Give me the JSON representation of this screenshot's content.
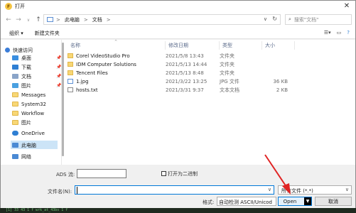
{
  "window": {
    "title": "打开",
    "app_icon": "F",
    "close_glyph": "✕"
  },
  "nav": {
    "back": "←",
    "forward": "→",
    "up_dropdown": "∨",
    "up": "↑",
    "breadcrumbs": [
      "此电脑",
      "文档"
    ],
    "crumb_sep": ">",
    "search_placeholder": "搜索\"文档\""
  },
  "commands": {
    "organize": "组织 ▾",
    "new_folder": "新建文件夹"
  },
  "sidebar": {
    "items": [
      {
        "label": "快速访问",
        "icon": "star-icon",
        "color": "#3b7dd8"
      },
      {
        "label": "桌面",
        "icon": "desktop-icon",
        "color": "#3b8fe0",
        "pinned": true
      },
      {
        "label": "下载",
        "icon": "download-icon",
        "color": "#2f7fd3",
        "pinned": true
      },
      {
        "label": "文档",
        "icon": "documents-icon",
        "color": "#8aa4c8",
        "pinned": true
      },
      {
        "label": "图片",
        "icon": "pictures-icon",
        "color": "#4aa0e0",
        "pinned": true
      },
      {
        "label": "Messages",
        "icon": "folder-icon",
        "color": "#f8d775"
      },
      {
        "label": "System32",
        "icon": "folder-icon",
        "color": "#f8d775"
      },
      {
        "label": "Workflow",
        "icon": "folder-icon",
        "color": "#f8d775"
      },
      {
        "label": "图片",
        "icon": "folder-icon",
        "color": "#f8d775"
      },
      {
        "label": "OneDrive",
        "icon": "onedrive-icon",
        "color": "#2f7fd3"
      },
      {
        "label": "此电脑",
        "icon": "computer-icon",
        "color": "#4a8ad4",
        "selected": true
      },
      {
        "label": "网络",
        "icon": "network-icon",
        "color": "#4a8ad4"
      }
    ],
    "pin_glyph": "📌"
  },
  "file_list": {
    "headers": [
      "名称",
      "修改日期",
      "类型",
      "大小"
    ],
    "sort_glyph": "^",
    "rows": [
      {
        "name": "Corel VideoStudio Pro",
        "date": "2021/5/8 13:43",
        "type": "文件夹",
        "size": "",
        "kind": "folder"
      },
      {
        "name": "IDM Computer Solutions",
        "date": "2021/5/13 14:44",
        "type": "文件夹",
        "size": "",
        "kind": "folder"
      },
      {
        "name": "Tencent Files",
        "date": "2021/5/13 8:48",
        "type": "文件夹",
        "size": "",
        "kind": "folder"
      },
      {
        "name": "1.jpg",
        "date": "2021/3/22 13:25",
        "type": "JPG 文件",
        "size": "36 KB",
        "kind": "image"
      },
      {
        "name": "hosts.txt",
        "date": "2021/3/31 9:37",
        "type": "文本文档",
        "size": "2 KB",
        "kind": "text"
      }
    ]
  },
  "bottom": {
    "ads_label": "ADS 流:",
    "binary_label": "打开为二进制",
    "filename_label": "文件名(N):",
    "filename_value": "",
    "filetype_value": "所有文件 (*.*)",
    "encoding_label": "格式:",
    "encoding_value": "自动检测 ASCII/Unicod",
    "open_label": "Open",
    "cancel_label": "取消"
  },
  "terminal_text": "[1] 33 43 1 f wrk_at_43bs 1 f"
}
